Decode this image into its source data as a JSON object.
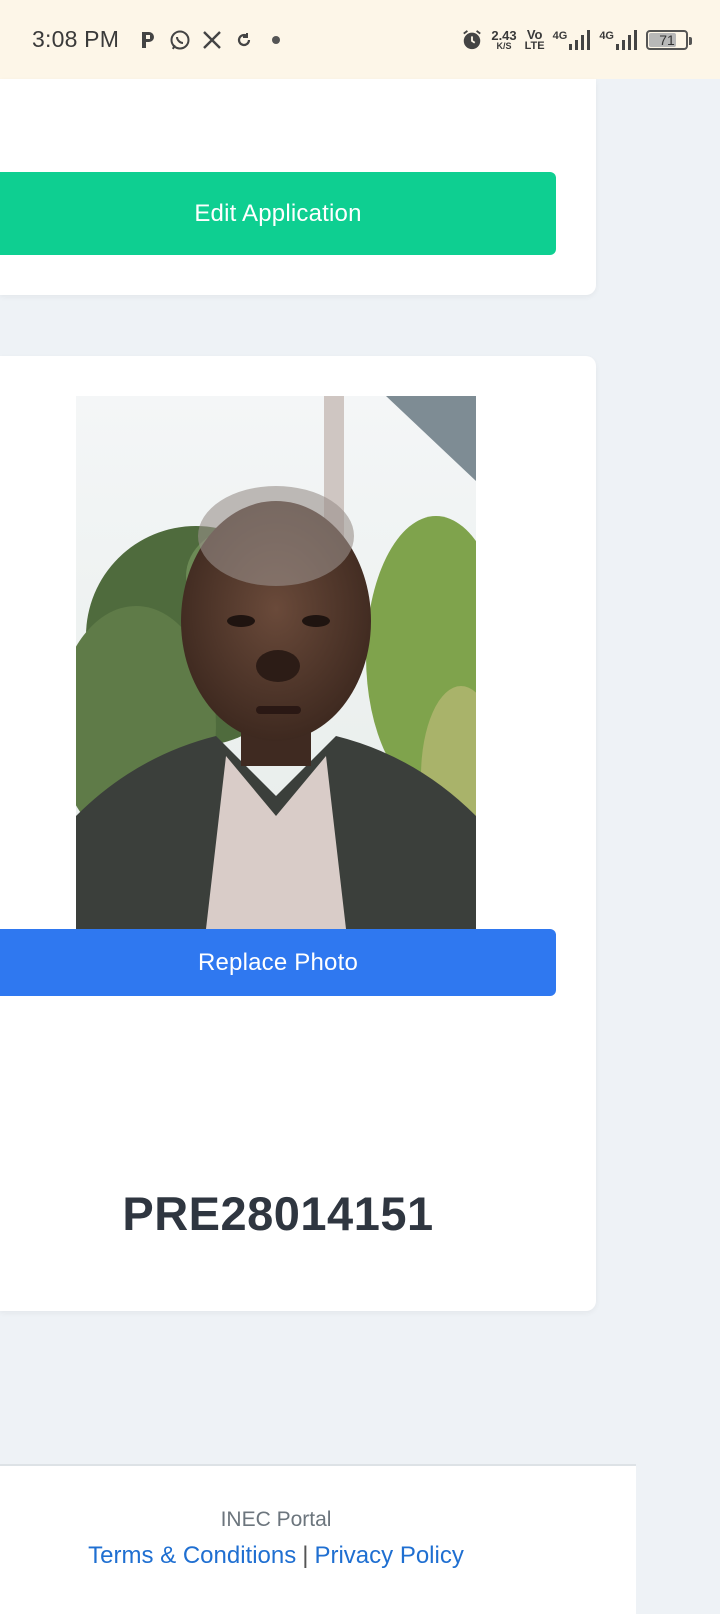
{
  "status_bar": {
    "time": "3:08 PM",
    "left_icons": [
      "p-icon",
      "whatsapp-icon",
      "x-icon",
      "sync-icon",
      "dot-icon"
    ],
    "right_icons": [
      "alarm-icon",
      "net-speed",
      "volte-icon",
      "signal-4g-icon",
      "signal-4g-icon",
      "battery-icon"
    ],
    "net_speed_value": "2.43",
    "net_speed_unit": "K/S",
    "volte_top": "Vo",
    "volte_bottom": "LTE",
    "network_label_1": "4G",
    "network_label_2": "4G",
    "battery_level": "71"
  },
  "application_card": {
    "edit_button_label": "Edit Application"
  },
  "photo_card": {
    "replace_button_label": "Replace Photo",
    "application_id": "PRE28014151"
  },
  "footer": {
    "portal_name": "INEC Portal",
    "terms_label": "Terms & Conditions",
    "separator": "|",
    "privacy_label": "Privacy Policy"
  },
  "colors": {
    "edit_button": "#0ecf91",
    "replace_button": "#2f78f0",
    "link": "#1f6fd1",
    "page_background": "#eef2f6",
    "status_bar_background": "#fdf6e8"
  }
}
